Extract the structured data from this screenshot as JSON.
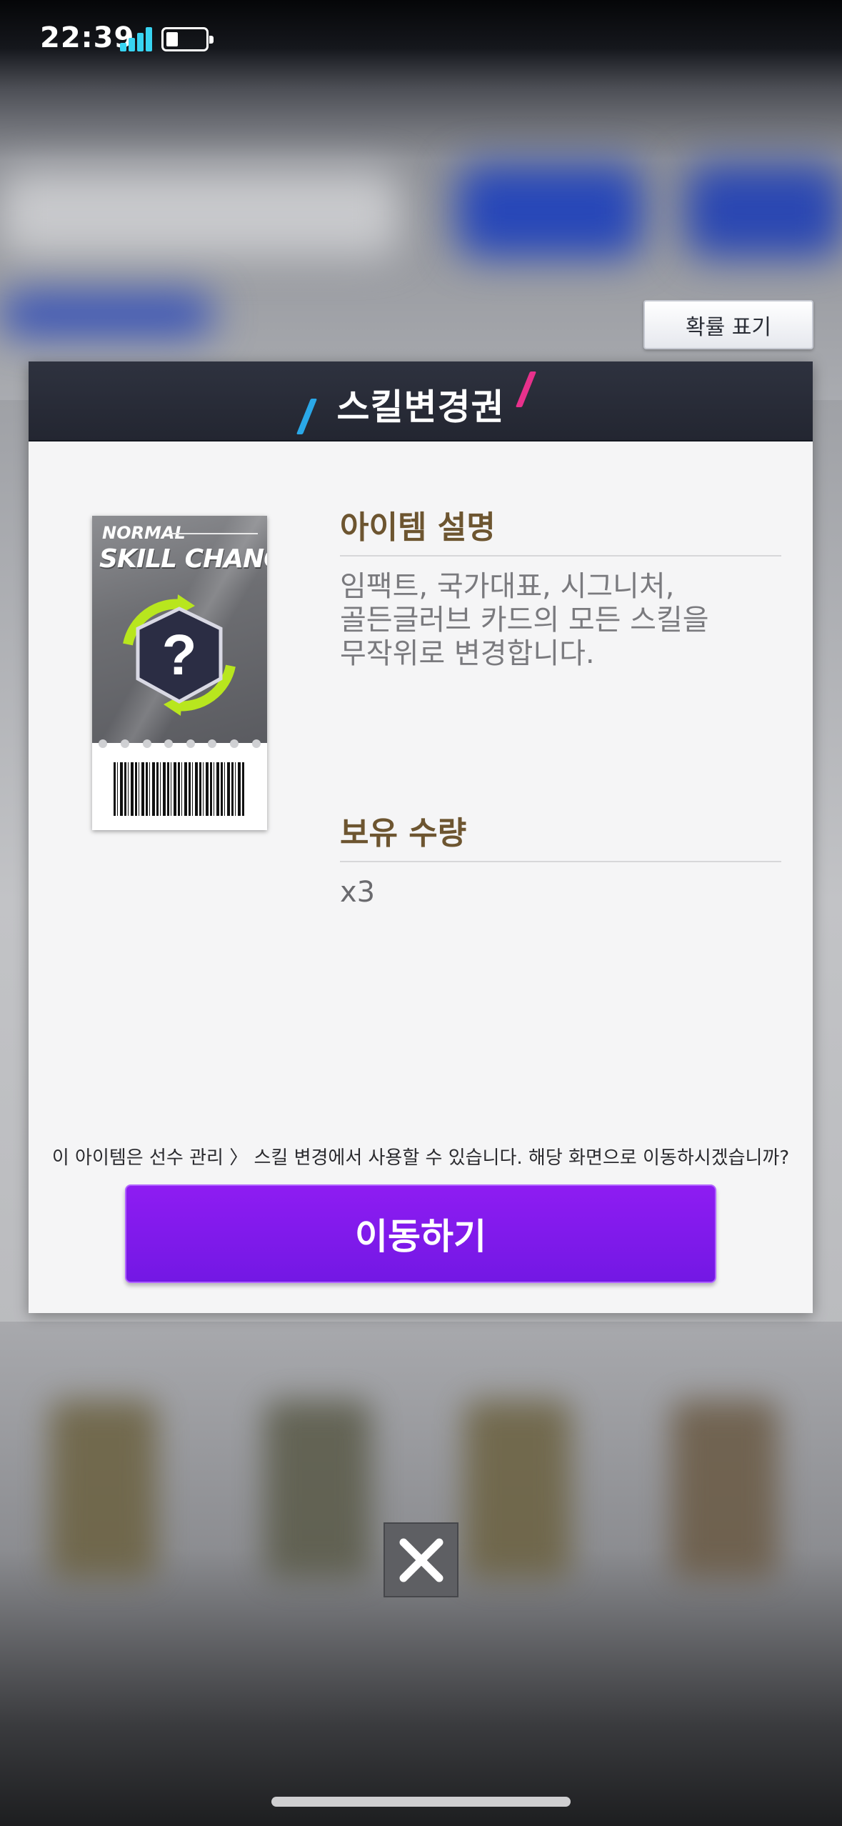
{
  "status_bar": {
    "time": "22:39",
    "battery_level": 0.3,
    "signal_color": "#38d4f2"
  },
  "probability_button": {
    "label": "확률 표기"
  },
  "modal": {
    "title": "스킬변경권",
    "ticket": {
      "line1": "NORMAL",
      "line2": "SKILL CHANGE",
      "emblem_glyph": "?"
    },
    "description_title": "아이템 설명",
    "description_lines": [
      "임팩트, 국가대표, 시그니처,",
      "골든글러브 카드의 모든 스킬을",
      "무작위로 변경합니다."
    ],
    "owned_title": "보유 수량",
    "owned_count": "x3",
    "notice": "이 아이템은 선수 관리 〉 스킬 변경에서 사용할 수 있습니다. 해당 화면으로 이동하시겠습니까?",
    "move_button": "이동하기"
  },
  "close_button": {
    "icon": "close-icon"
  },
  "colors": {
    "accent_purple": "#7a19e8",
    "header_dark": "#2a2e3a",
    "section_title": "#6d5530",
    "slash_blue": "#2aa8e8",
    "slash_pink": "#e8318c"
  }
}
